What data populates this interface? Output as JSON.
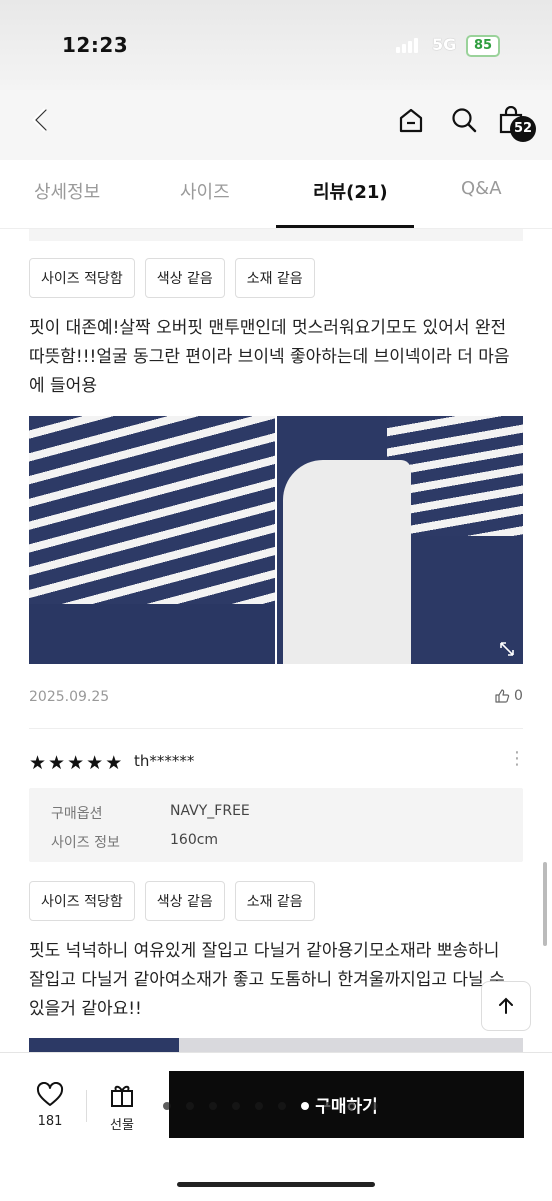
{
  "status": {
    "time": "12:23",
    "network": "5G",
    "battery": "85"
  },
  "nav": {
    "cart_count": "52"
  },
  "tabs": [
    {
      "label": "상세정보"
    },
    {
      "label": "사이즈"
    },
    {
      "label": "리뷰(21)"
    },
    {
      "label": "Q&A"
    }
  ],
  "review1": {
    "chips": [
      "사이즈 적당함",
      "색상 같음",
      "소재 같음"
    ],
    "text": "핏이 대존예!살짝 오버핏 맨투맨인데 멋스러워요기모도 있어서 완전 따뜻함!!!얼굴 동그란 편이라 브이넥 좋아하는데 브이넥이라 더 마음에 들어용",
    "date": "2025.09.25",
    "likes": "0"
  },
  "review2": {
    "rating": 5,
    "reviewer": "th******",
    "options": [
      {
        "key": "구매옵션",
        "value": "NAVY_FREE"
      },
      {
        "key": "사이즈 정보",
        "value": "160cm"
      }
    ],
    "chips": [
      "사이즈 적당함",
      "색상 같음",
      "소재 같음"
    ],
    "text": "핏도 넉넉하니 여유있게 잘입고 다닐거 같아용기모소재라 뽀송하니 잘입고 다닐거 같아여소재가 좋고 도톰하니 한겨울까지입고 다닐 수 있을거 같아요!!"
  },
  "bottom": {
    "wish_count": "181",
    "gift_label": "선물",
    "buy_label": "구매하기"
  },
  "colors": {
    "accent": "#111111",
    "stripe_navy": "#2d3a66"
  }
}
